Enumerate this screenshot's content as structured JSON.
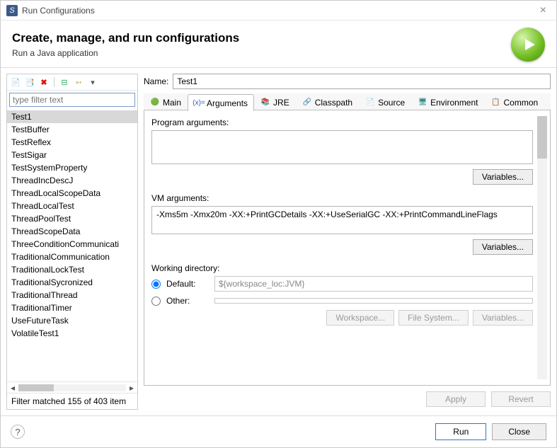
{
  "window": {
    "title": "Run Configurations"
  },
  "header": {
    "title": "Create, manage, and run configurations",
    "subtitle": "Run a Java application"
  },
  "sidebar": {
    "filter_placeholder": "type filter text",
    "items": [
      "Test1",
      "TestBuffer",
      "TestReflex",
      "TestSigar",
      "TestSystemProperty",
      "ThreadIncDescJ",
      "ThreadLocalScopeData",
      "ThreadLocalTest",
      "ThreadPoolTest",
      "ThreadScopeData",
      "ThreeConditionCommunicati",
      "TraditionalCommunication",
      "TraditionalLockTest",
      "TraditionalSycronized",
      "TraditionalThread",
      "TraditionalTimer",
      "UseFutureTask",
      "VolatileTest1"
    ],
    "selected_index": 0,
    "filter_status": "Filter matched 155 of 403 item"
  },
  "name": {
    "label": "Name:",
    "value": "Test1"
  },
  "tabs": {
    "items": [
      {
        "label": "Main"
      },
      {
        "label": "Arguments"
      },
      {
        "label": "JRE"
      },
      {
        "label": "Classpath"
      },
      {
        "label": "Source"
      },
      {
        "label": "Environment"
      },
      {
        "label": "Common"
      }
    ],
    "active_index": 1
  },
  "args": {
    "program_label": "Program arguments:",
    "program_value": "",
    "vm_label": "VM arguments:",
    "vm_value": "-Xms5m -Xmx20m -XX:+PrintGCDetails -XX:+UseSerialGC -XX:+PrintCommandLineFlags",
    "variables_btn": "Variables...",
    "workdir_label": "Working directory:",
    "default_label": "Default:",
    "default_value": "${workspace_loc:JVM}",
    "other_label": "Other:",
    "workspace_btn": "Workspace...",
    "filesystem_btn": "File System...",
    "variables2_btn": "Variables..."
  },
  "buttons": {
    "apply": "Apply",
    "revert": "Revert",
    "run": "Run",
    "close": "Close"
  }
}
